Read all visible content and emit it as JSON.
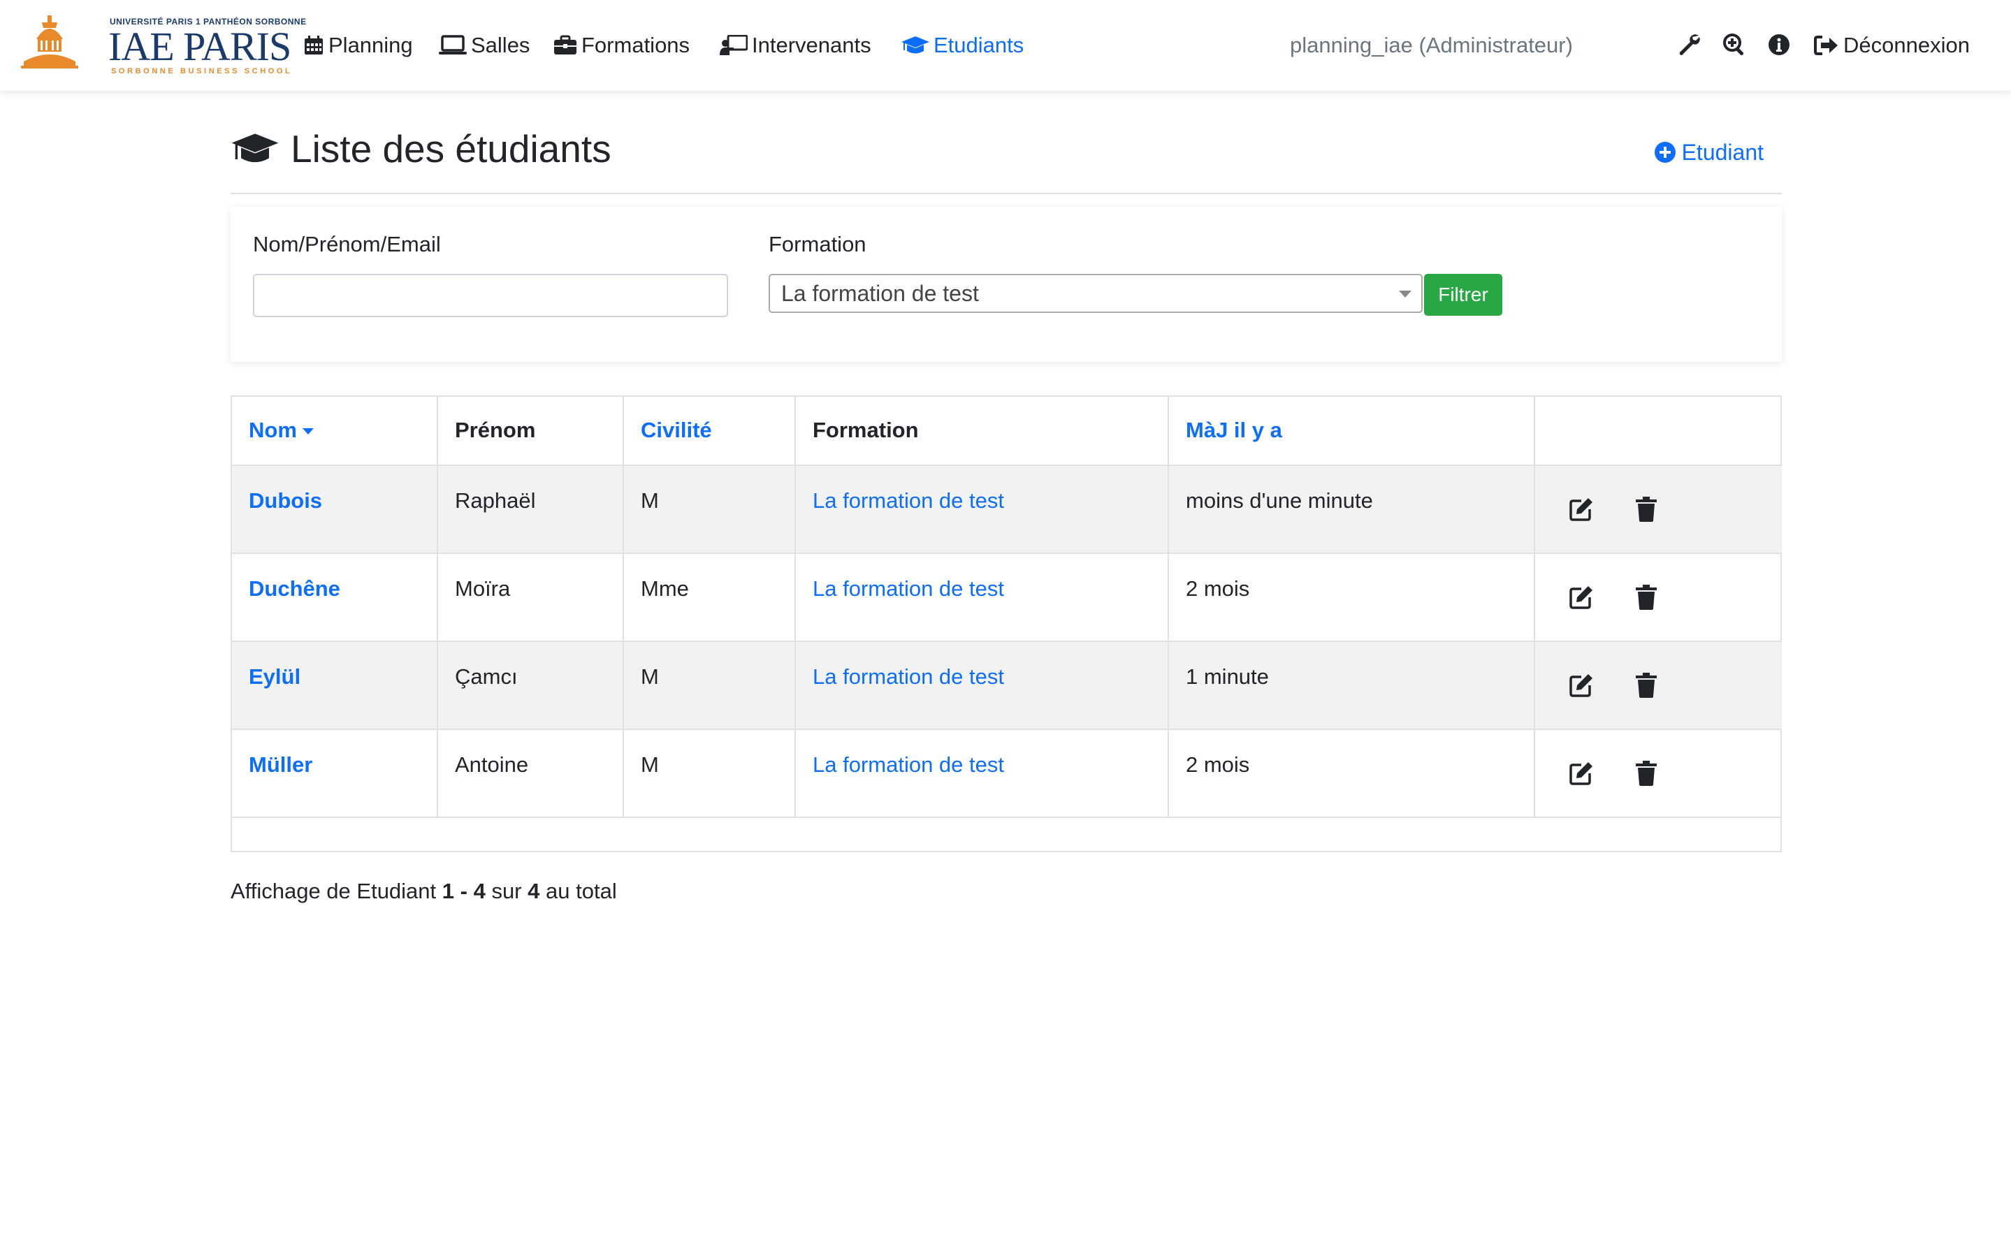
{
  "brand": {
    "university": "UNIVERSITÉ PARIS 1 PANTHÉON SORBONNE",
    "name": "IAE PARIS",
    "school": "SORBONNE BUSINESS SCHOOL"
  },
  "nav": {
    "items": [
      {
        "label": "Planning",
        "icon": "calendar-icon"
      },
      {
        "label": "Salles",
        "icon": "laptop-icon"
      },
      {
        "label": "Formations",
        "icon": "briefcase-icon"
      },
      {
        "label": "Intervenants",
        "icon": "chalkboard-teacher-icon"
      },
      {
        "label": "Etudiants",
        "icon": "graduation-cap-icon",
        "active": true
      }
    ],
    "user": "planning_iae (Administrateur)",
    "logout": "Déconnexion"
  },
  "page": {
    "title": "Liste des étudiants",
    "add_label": "Etudiant"
  },
  "filters": {
    "search_label": "Nom/Prénom/Email",
    "search_value": "",
    "formation_label": "Formation",
    "formation_selected": "La formation de test",
    "submit_label": "Filtrer"
  },
  "table": {
    "columns": [
      "Nom",
      "Prénom",
      "Civilité",
      "Formation",
      "MàJ il y a",
      ""
    ],
    "rows": [
      {
        "nom": "Dubois",
        "prenom": "Raphaël",
        "civilite": "M",
        "formation": "La formation de test",
        "maj": "moins d'une minute"
      },
      {
        "nom": "Duchêne",
        "prenom": "Moïra",
        "civilite": "Mme",
        "formation": "La formation de test",
        "maj": "2 mois"
      },
      {
        "nom": "Eylül",
        "prenom": "Çamcı",
        "civilite": "M",
        "formation": "La formation de test",
        "maj": "1 minute"
      },
      {
        "nom": "Müller",
        "prenom": "Antoine",
        "civilite": "M",
        "formation": "La formation de test",
        "maj": "2 mois"
      }
    ]
  },
  "summary": {
    "prefix": "Affichage de Etudiant",
    "range": "1 - 4",
    "mid": "sur",
    "total": "4",
    "suffix": "au total"
  },
  "colors": {
    "primary": "#0d6efd",
    "success": "#28a745",
    "brand_blue": "#1a3a6b",
    "brand_orange": "#e88a2a",
    "stripe": "#f2f2f2"
  }
}
